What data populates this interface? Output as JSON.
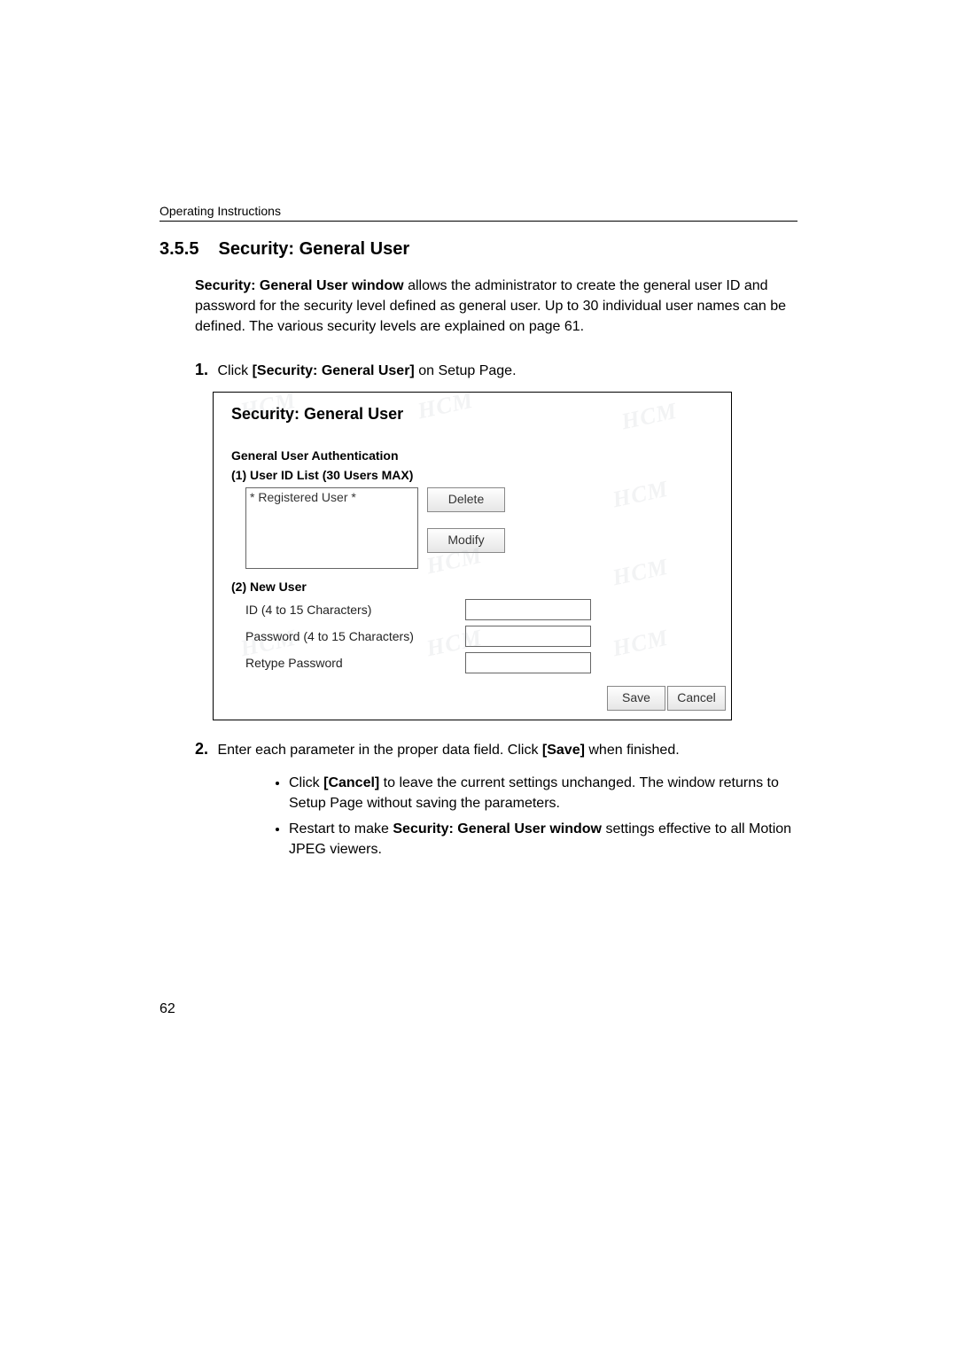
{
  "header": "Operating Instructions",
  "section_number": "3.5.5",
  "section_title": "Security: General User",
  "body_paragraph_parts": {
    "p1_bold": "Security: General User window",
    "p1_rest": " allows the administrator to create the general user ID and password for the security level defined as general user. Up to 30 individual user names can be defined. The various security levels are explained on page 61."
  },
  "steps": {
    "s1_num": "1.",
    "s1_text_pre": "Click ",
    "s1_bold": "[Security: General User]",
    "s1_text_post": " on Setup Page.",
    "s2_num": "2.",
    "s2_text_pre": "Enter each parameter in the proper data field. Click ",
    "s2_bold": "[Save]",
    "s2_text_post": " when finished."
  },
  "bullets": {
    "b1_pre": "Click ",
    "b1_bold": "[Cancel]",
    "b1_post": " to leave the current settings unchanged. The window returns to Setup Page without saving the parameters.",
    "b2_pre": "Restart to make ",
    "b2_bold": "Security: General User window",
    "b2_post": " settings effective to all Motion JPEG viewers."
  },
  "ui": {
    "title": "Security: General User",
    "auth_heading": "General User Authentication",
    "list_heading": "(1)  User ID List (30 Users MAX)",
    "list_item": "* Registered User *",
    "delete_btn": "Delete",
    "modify_btn": "Modify",
    "newuser_heading": "(2)  New User",
    "id_label": "ID (4 to 15 Characters)",
    "pw_label": "Password (4 to 15 Characters)",
    "rpw_label": "Retype Password",
    "save_btn": "Save",
    "cancel_btn": "Cancel"
  },
  "page_number": "62",
  "watermark": "HCM"
}
